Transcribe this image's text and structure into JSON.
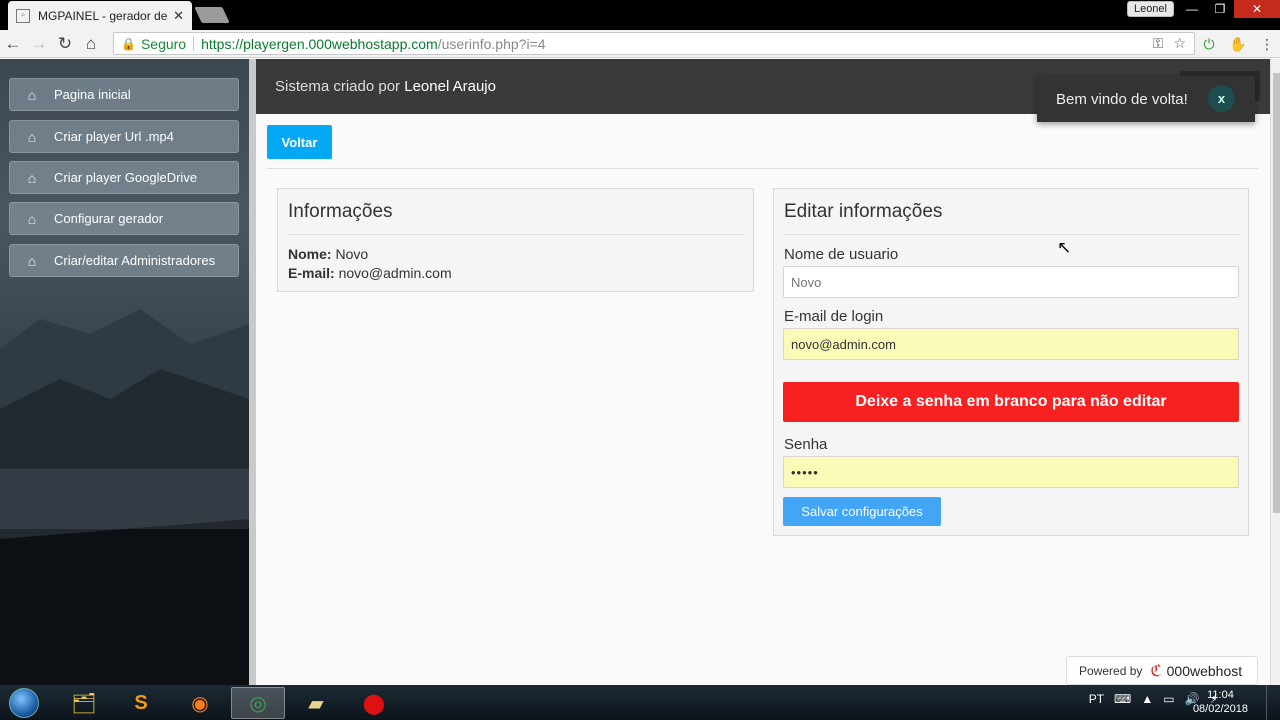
{
  "browser": {
    "tab_title": "MGPAINEL - gerador de",
    "user_label": "Leonel",
    "secure_label": "Seguro",
    "url_host": "https://playergen.000webhostapp.com",
    "url_path": "/userinfo.php?i=4"
  },
  "sidebar": {
    "items": [
      {
        "label": "Pagina inicial"
      },
      {
        "label": "Criar player Url .mp4"
      },
      {
        "label": "Criar player GoogleDrive"
      },
      {
        "label": "Configurar gerador"
      },
      {
        "label": "Criar/editar Administradores"
      }
    ]
  },
  "header": {
    "prefix": "Sistema criado por",
    "author": "Leonel Araujo"
  },
  "toast": {
    "message": "Bem vindo de volta!",
    "close_label": "x"
  },
  "page": {
    "back_label": "Voltar"
  },
  "info_panel": {
    "title": "Informações",
    "name_label": "Nome:",
    "name_value": "Novo",
    "email_label": "E-mail:",
    "email_value": "novo@admin.com"
  },
  "edit_panel": {
    "title": "Editar informações",
    "username_label": "Nome de usuario",
    "username_placeholder": "Novo",
    "email_label": "E-mail de login",
    "email_value": "novo@admin.com",
    "warning": "Deixe a senha em branco para não editar",
    "password_label": "Senha",
    "password_value": "•••••",
    "save_label": "Salvar configurações"
  },
  "footer": {
    "powered_by": "Powered by",
    "brand": "000webhost"
  },
  "taskbar": {
    "language": "PT",
    "time": "11:04",
    "date": "08/02/2018"
  },
  "colors": {
    "accent_button": "#03a9f4",
    "warning_bg": "#f72121",
    "save_button": "#42a5f5",
    "autofill_bg": "#fafbb7",
    "header_bg": "#3a3a3a"
  }
}
